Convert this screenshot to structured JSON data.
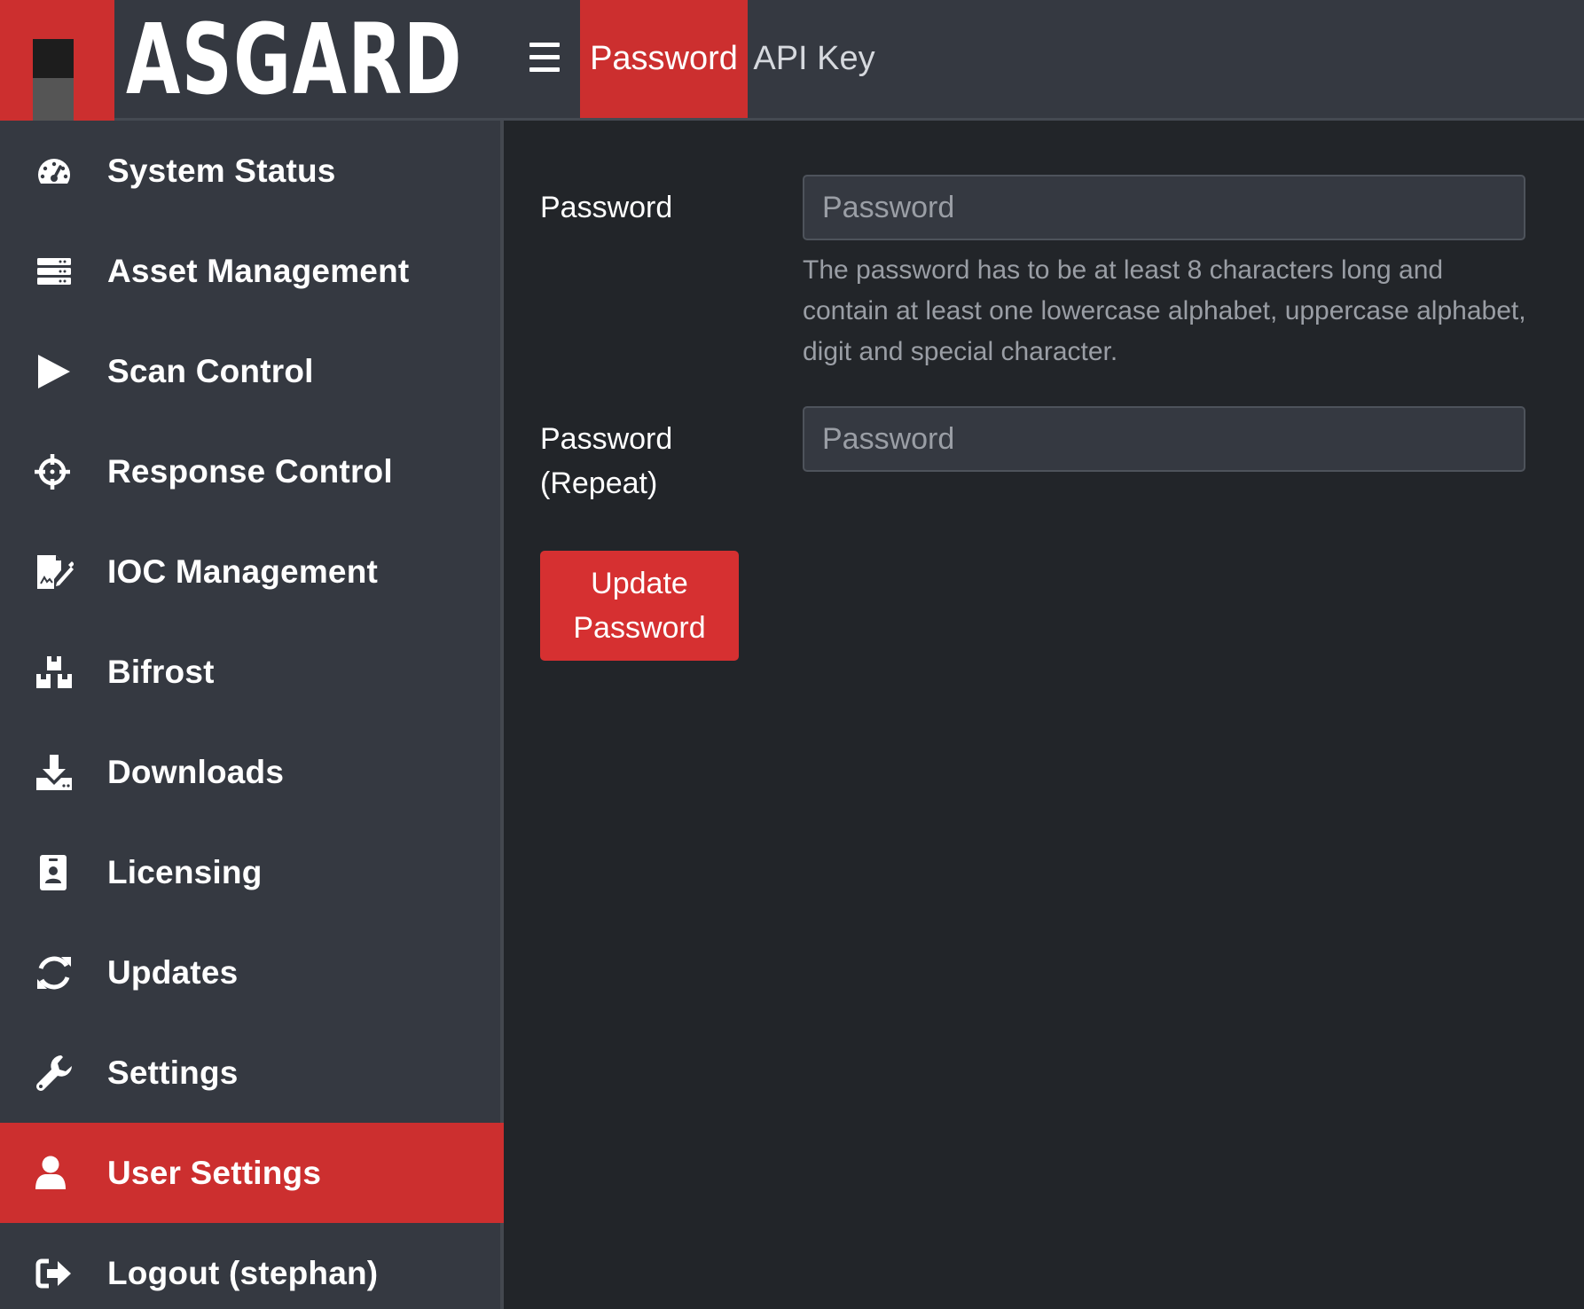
{
  "header": {
    "logo_text": "ASGARD",
    "tabs": [
      {
        "label": "Password",
        "active": true
      },
      {
        "label": "API Key",
        "active": false
      }
    ]
  },
  "sidebar": {
    "items": [
      {
        "label": "System Status",
        "icon": "tachometer-icon"
      },
      {
        "label": "Asset Management",
        "icon": "server-stack-icon"
      },
      {
        "label": "Scan Control",
        "icon": "play-icon"
      },
      {
        "label": "Response Control",
        "icon": "crosshairs-icon"
      },
      {
        "label": "IOC Management",
        "icon": "file-signature-icon"
      },
      {
        "label": "Bifrost",
        "icon": "cubes-icon"
      },
      {
        "label": "Downloads",
        "icon": "download-icon"
      },
      {
        "label": "Licensing",
        "icon": "id-badge-icon"
      },
      {
        "label": "Updates",
        "icon": "sync-icon"
      },
      {
        "label": "Settings",
        "icon": "wrench-icon"
      },
      {
        "label": "User Settings",
        "icon": "user-icon",
        "active": true
      },
      {
        "label": "Logout (stephan)",
        "icon": "sign-out-icon"
      }
    ]
  },
  "form": {
    "password_label": "Password",
    "password_placeholder": "Password",
    "help_text": "The password has to be at least 8 characters long and contain at least one lowercase alphabet, uppercase alphabet, digit and special character.",
    "password_repeat_label_line1": "Password",
    "password_repeat_label_line2": "(Repeat)",
    "password_repeat_placeholder": "Password",
    "submit_label": "Update Password"
  },
  "colors": {
    "accent": "#cc2f2f",
    "header_bg": "#353941",
    "sidebar_bg": "#353941",
    "main_bg": "#222529",
    "input_bg": "#353941",
    "muted_text": "#9a9ea5"
  }
}
